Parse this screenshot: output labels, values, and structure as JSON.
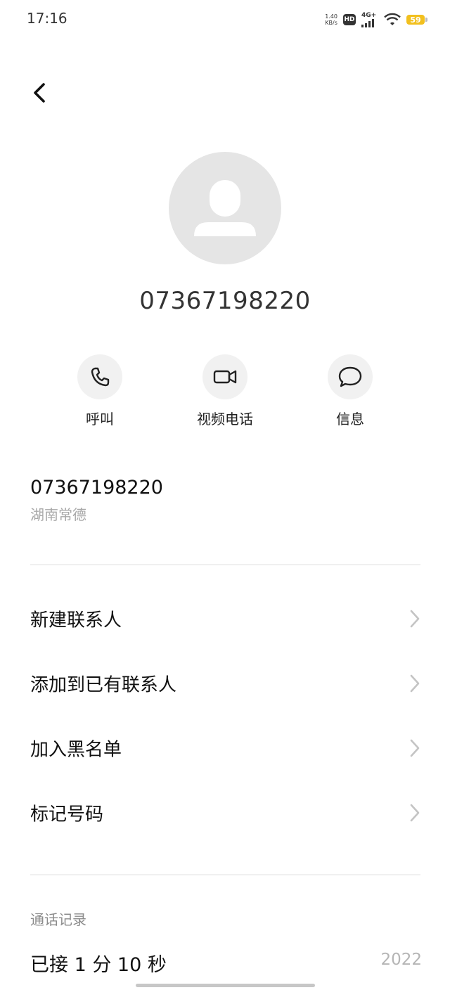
{
  "status_bar": {
    "time": "17:16",
    "net_speed_value": "1.40",
    "net_speed_unit": "KB/s",
    "hd_label": "HD",
    "network_label": "4G+",
    "battery_level": "59"
  },
  "header": {
    "back_icon": "chevron-left-icon"
  },
  "contact": {
    "avatar_icon": "person-icon",
    "number": "07367198220"
  },
  "actions": [
    {
      "label": "呼叫",
      "icon": "phone-icon"
    },
    {
      "label": "视频电话",
      "icon": "video-camera-icon"
    },
    {
      "label": "信息",
      "icon": "message-bubble-icon"
    }
  ],
  "info": {
    "number": "07367198220",
    "location": "湖南常德"
  },
  "menu": [
    {
      "label": "新建联系人"
    },
    {
      "label": "添加到已有联系人"
    },
    {
      "label": "加入黑名单"
    },
    {
      "label": "标记号码"
    }
  ],
  "call_log": {
    "header": "通话记录",
    "status": "已接 1 分 10 秒",
    "time": "2022"
  },
  "colors": {
    "avatar_bg": "#e5e5e5",
    "action_circle_bg": "#f1f1f1",
    "secondary_text": "#a8a8a8",
    "battery": "#f2c01e"
  }
}
